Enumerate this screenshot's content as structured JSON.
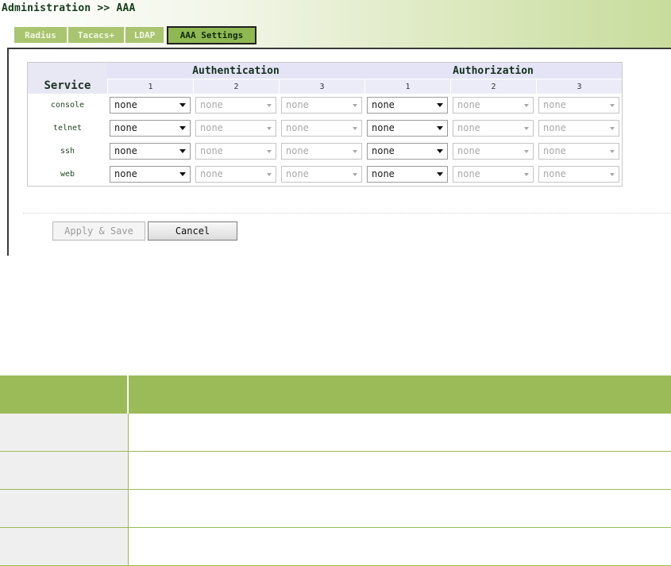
{
  "header": {
    "breadcrumb": "Administration >> AAA",
    "tabs": [
      {
        "label": "Radius",
        "active": false
      },
      {
        "label": "Tacacs+",
        "active": false
      },
      {
        "label": "LDAP",
        "active": false
      },
      {
        "label": "AAA Settings",
        "active": true
      }
    ]
  },
  "aaa_table": {
    "service_header": "Service",
    "groups": [
      {
        "label": "Authentication",
        "columns": [
          "1",
          "2",
          "3"
        ]
      },
      {
        "label": "Authorization",
        "columns": [
          "1",
          "2",
          "3"
        ]
      }
    ],
    "rows": [
      {
        "service": "console",
        "authentication": [
          "none",
          "none",
          "none"
        ],
        "authorization": [
          "none",
          "none",
          "none"
        ]
      },
      {
        "service": "telnet",
        "authentication": [
          "none",
          "none",
          "none"
        ],
        "authorization": [
          "none",
          "none",
          "none"
        ]
      },
      {
        "service": "ssh",
        "authentication": [
          "none",
          "none",
          "none"
        ],
        "authorization": [
          "none",
          "none",
          "none"
        ]
      },
      {
        "service": "web",
        "authentication": [
          "none",
          "none",
          "none"
        ],
        "authorization": [
          "none",
          "none",
          "none"
        ]
      }
    ],
    "enabled_columns": [
      true,
      false,
      false
    ]
  },
  "buttons": {
    "apply_save": "Apply & Save",
    "cancel": "Cancel"
  },
  "description_table": {
    "headers": [
      "",
      ""
    ],
    "rows": [
      [
        "",
        ""
      ],
      [
        "",
        ""
      ],
      [
        "",
        ""
      ],
      [
        "",
        ""
      ]
    ]
  },
  "colors": {
    "tab_inactive": "#a9c56f",
    "tab_active": "#8fb752",
    "table_header_bg": "#e4e4f6",
    "lower_table_header": "#9bbb59"
  }
}
